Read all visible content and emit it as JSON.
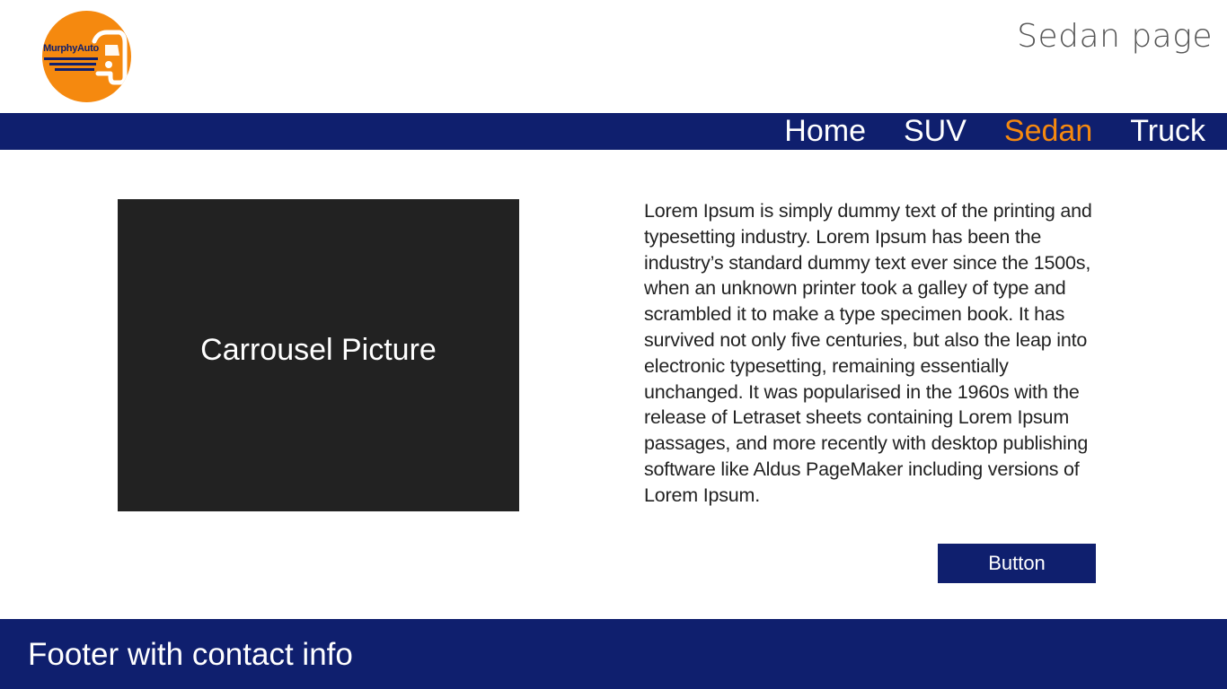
{
  "header": {
    "logo_text": "MurphyAuto",
    "page_title": "Sedan page"
  },
  "nav": {
    "items": [
      {
        "label": "Home",
        "active": false
      },
      {
        "label": "SUV",
        "active": false
      },
      {
        "label": "Sedan",
        "active": true
      },
      {
        "label": "Truck",
        "active": false
      }
    ]
  },
  "main": {
    "carousel_label": "Carrousel Picture",
    "body_text": "Lorem Ipsum is simply dummy text of the printing and typesetting industry. Lorem Ipsum has been the industry’s standard dummy text ever since the 1500s, when an unknown printer took a galley of type and scrambled it to make a type specimen book. It has survived not only five centuries, but also the leap into electronic typesetting, remaining essentially unchanged. It was popularised in the 1960s with the release of Letraset sheets containing Lorem Ipsum passages, and more recently with desktop publishing software like Aldus PageMaker including versions of Lorem Ipsum.",
    "button_label": "Button"
  },
  "footer": {
    "text": "Footer with contact info"
  },
  "colors": {
    "brand_navy": "#0f1f6e",
    "brand_orange": "#f5890f",
    "carousel_bg": "#222222"
  },
  "icons": {
    "logo": "car-front-icon"
  }
}
